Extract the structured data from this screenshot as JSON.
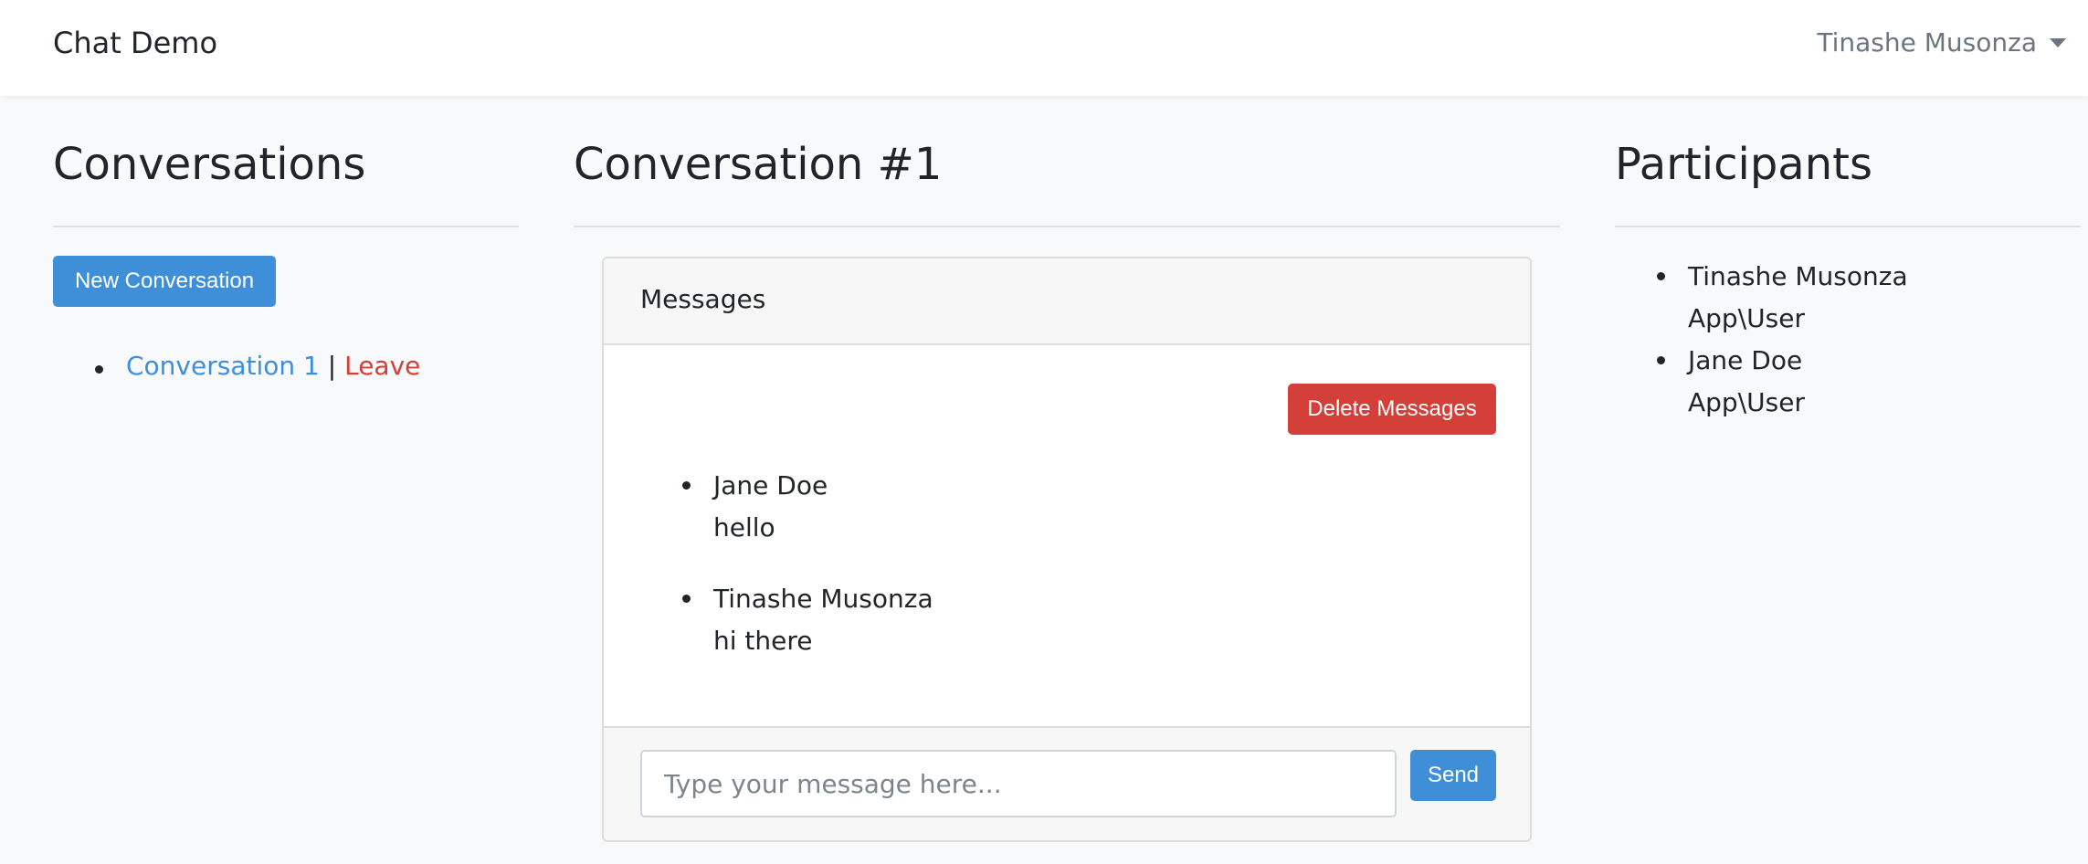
{
  "navbar": {
    "brand": "Chat Demo",
    "user_name": "Tinashe Musonza"
  },
  "conversations": {
    "title": "Conversations",
    "new_button": "New Conversation",
    "items": [
      {
        "label": "Conversation 1",
        "separator": "|",
        "leave_label": "Leave"
      }
    ]
  },
  "conversation": {
    "title": "Conversation #1",
    "card_header": "Messages",
    "delete_button": "Delete Messages",
    "messages": [
      {
        "sender": "Jane Doe",
        "text": "hello"
      },
      {
        "sender": "Tinashe Musonza",
        "text": "hi there"
      }
    ],
    "input_placeholder": "Type your message here...",
    "send_button": "Send"
  },
  "participants": {
    "title": "Participants",
    "items": [
      {
        "name": "Tinashe Musonza",
        "type": "App\\User"
      },
      {
        "name": "Jane Doe",
        "type": "App\\User"
      }
    ]
  },
  "colors": {
    "primary": "#3f8fd8",
    "danger": "#d43f3a",
    "background": "#f8f9fa"
  }
}
